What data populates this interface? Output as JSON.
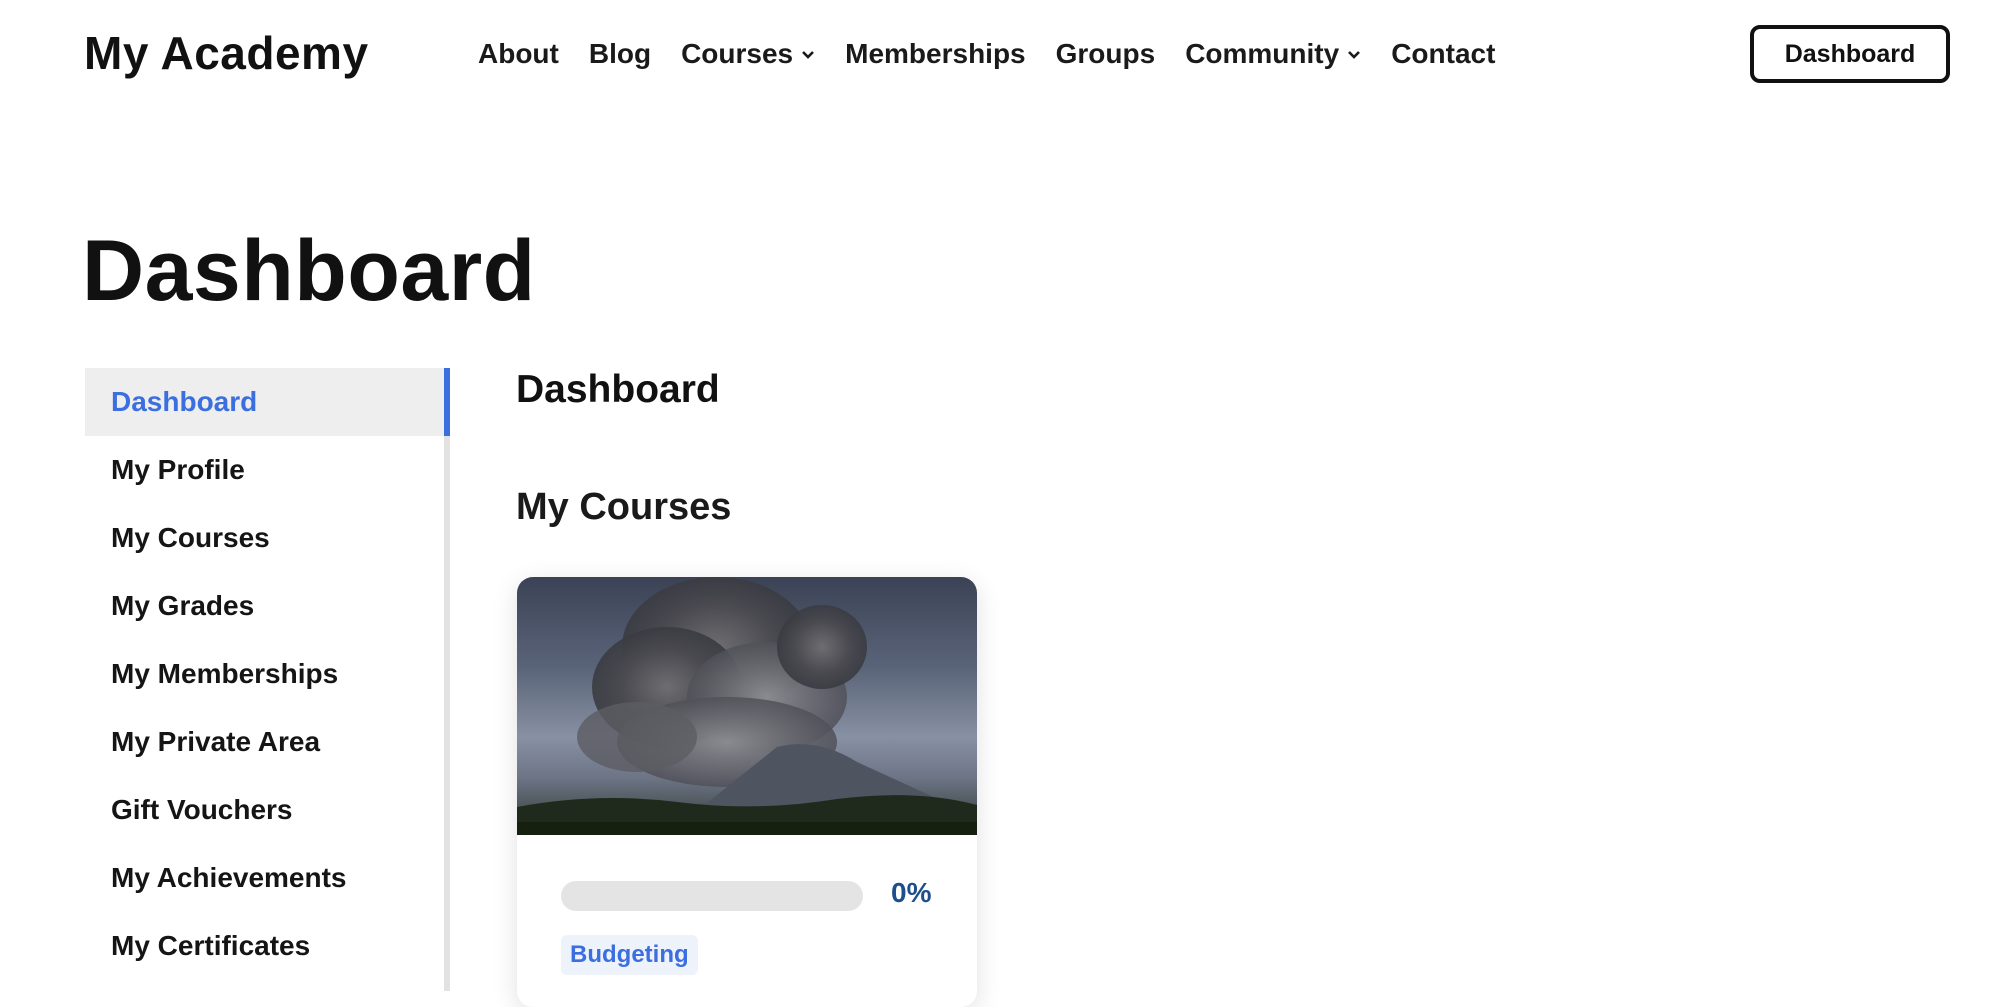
{
  "header": {
    "logo": "My Academy",
    "nav": [
      {
        "label": "About",
        "has_dropdown": false
      },
      {
        "label": "Blog",
        "has_dropdown": false
      },
      {
        "label": "Courses",
        "has_dropdown": true
      },
      {
        "label": "Memberships",
        "has_dropdown": false
      },
      {
        "label": "Groups",
        "has_dropdown": false
      },
      {
        "label": "Community",
        "has_dropdown": true
      },
      {
        "label": "Contact",
        "has_dropdown": false
      }
    ],
    "dashboard_button": "Dashboard"
  },
  "page": {
    "title": "Dashboard"
  },
  "sidebar": {
    "items": [
      {
        "label": "Dashboard",
        "active": true
      },
      {
        "label": "My Profile",
        "active": false
      },
      {
        "label": "My Courses",
        "active": false
      },
      {
        "label": "My Grades",
        "active": false
      },
      {
        "label": "My Memberships",
        "active": false
      },
      {
        "label": "My Private Area",
        "active": false
      },
      {
        "label": "Gift Vouchers",
        "active": false
      },
      {
        "label": "My Achievements",
        "active": false
      },
      {
        "label": "My Certificates",
        "active": false
      }
    ]
  },
  "main": {
    "title": "Dashboard",
    "section_title": "My Courses",
    "courses": [
      {
        "progress": 0,
        "progress_label": "0%",
        "category": "Budgeting"
      }
    ]
  },
  "colors": {
    "accent": "#3b6fe0",
    "progress_text": "#1f4f8a",
    "text": "#111111",
    "sidebar_active_bg": "#eeeeee"
  }
}
